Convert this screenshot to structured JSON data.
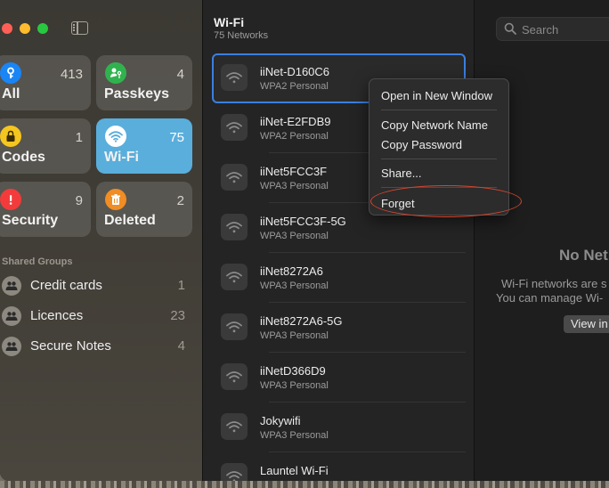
{
  "sidebar": {
    "tiles": {
      "all": {
        "label": "All",
        "count": "413"
      },
      "passkeys": {
        "label": "Passkeys",
        "count": "4"
      },
      "codes": {
        "label": "Codes",
        "count": "1"
      },
      "wifi": {
        "label": "Wi-Fi",
        "count": "75"
      },
      "security": {
        "label": "Security",
        "count": "9"
      },
      "deleted": {
        "label": "Deleted",
        "count": "2"
      }
    },
    "shared_groups_header": "Shared Groups",
    "groups": [
      {
        "label": "Credit cards",
        "count": "1"
      },
      {
        "label": "Licences",
        "count": "23"
      },
      {
        "label": "Secure Notes",
        "count": "4"
      }
    ]
  },
  "list": {
    "title": "Wi-Fi",
    "subtitle": "75 Networks",
    "networks": [
      {
        "name": "iiNet-D160C6",
        "security": "WPA2 Personal"
      },
      {
        "name": "iiNet-E2FDB9",
        "security": "WPA2 Personal"
      },
      {
        "name": "iiNet5FCC3F",
        "security": "WPA3 Personal"
      },
      {
        "name": "iiNet5FCC3F-5G",
        "security": "WPA3 Personal"
      },
      {
        "name": "iiNet8272A6",
        "security": "WPA3 Personal"
      },
      {
        "name": "iiNet8272A6-5G",
        "security": "WPA3 Personal"
      },
      {
        "name": "iiNetD366D9",
        "security": "WPA3 Personal"
      },
      {
        "name": "Jokywifi",
        "security": "WPA3 Personal"
      },
      {
        "name": "Launtel Wi-Fi",
        "security": ""
      }
    ]
  },
  "detail": {
    "search_placeholder": "Search",
    "empty_title": "No Net",
    "empty_line1": "Wi-Fi networks are s",
    "empty_line2": "You can manage Wi-",
    "view_button": "View in"
  },
  "context_menu": {
    "open_new_window": "Open in New Window",
    "copy_network_name": "Copy Network Name",
    "copy_password": "Copy Password",
    "share": "Share...",
    "forget": "Forget"
  },
  "colors": {
    "accent": "#3b7fe0",
    "wifi_tile": "#5aaedb",
    "annotation_ring": "#d9462f"
  }
}
